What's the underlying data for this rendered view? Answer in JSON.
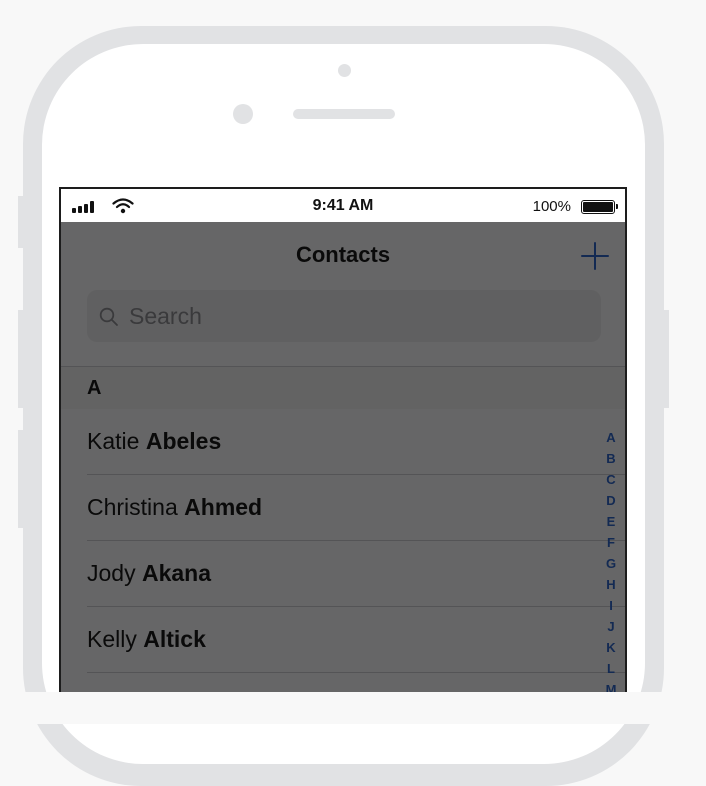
{
  "status_bar": {
    "time": "9:41 AM",
    "battery_percent": "100%",
    "signal_icon": "cellular-signal-icon",
    "wifi_icon": "wifi-icon",
    "battery_icon": "battery-full-icon"
  },
  "navigation": {
    "title": "Contacts",
    "add_icon": "plus-icon"
  },
  "search": {
    "placeholder": "Search",
    "value": "",
    "icon": "search-icon"
  },
  "section": {
    "letter": "A"
  },
  "contacts": [
    {
      "first": "Katie",
      "last": "Abeles"
    },
    {
      "first": "Christina",
      "last": "Ahmed"
    },
    {
      "first": "Jody",
      "last": "Akana"
    },
    {
      "first": "Kelly",
      "last": "Altick"
    }
  ],
  "index_letters": [
    "A",
    "B",
    "C",
    "D",
    "E",
    "F",
    "G",
    "H",
    "I",
    "J",
    "K",
    "L",
    "M"
  ],
  "colors": {
    "accent": "#2f64c7",
    "overlay": "rgba(0,0,0,0.58)",
    "device_frame": "#e1e2e4"
  }
}
